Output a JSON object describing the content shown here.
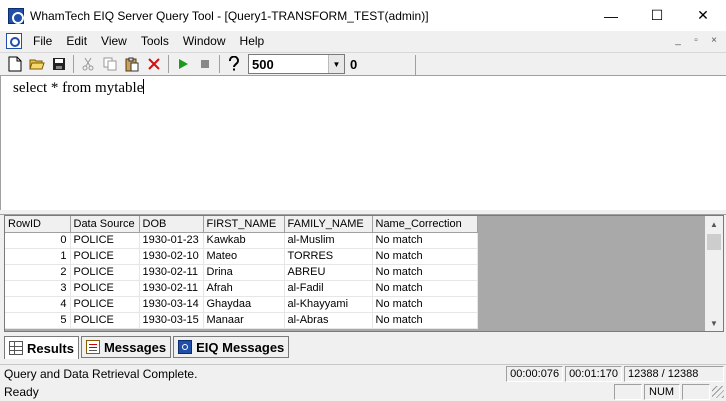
{
  "window": {
    "title": "WhamTech EIQ Server Query Tool - [Query1-TRANSFORM_TEST(admin)]",
    "minimize": "—",
    "maximize": "☐",
    "close": "✕"
  },
  "menu": {
    "items": [
      "File",
      "Edit",
      "View",
      "Tools",
      "Window",
      "Help"
    ],
    "mdi_minimize": "_",
    "mdi_restore": "▫",
    "mdi_close": "×"
  },
  "toolbar": {
    "row_limit": "500",
    "row_count": "0",
    "icons": {
      "new": "new-document-icon",
      "open": "open-folder-icon",
      "save": "save-icon",
      "cut": "cut-icon",
      "copy": "copy-icon",
      "paste": "paste-icon",
      "delete": "delete-icon",
      "run": "run-icon",
      "stop": "stop-icon",
      "help": "help-icon"
    },
    "colors": {
      "run": "#1a9a1a",
      "delete": "#d01010"
    }
  },
  "editor": {
    "query": "select * from mytable"
  },
  "results": {
    "columns": [
      "RowID",
      "Data Source",
      "DOB",
      "FIRST_NAME",
      "FAMILY_NAME",
      "Name_Correction"
    ],
    "rows": [
      [
        "0",
        "POLICE",
        "1930-01-23",
        "Kawkab",
        "al-Muslim",
        "No match"
      ],
      [
        "1",
        "POLICE",
        "1930-02-10",
        "Mateo",
        "TORRES",
        "No match"
      ],
      [
        "2",
        "POLICE",
        "1930-02-11",
        "Drina",
        "ABREU",
        "No match"
      ],
      [
        "3",
        "POLICE",
        "1930-02-11",
        "Afrah",
        "al-Fadil",
        "No match"
      ],
      [
        "4",
        "POLICE",
        "1930-03-14",
        "Ghaydaa",
        "al-Khayyami",
        "No match"
      ],
      [
        "5",
        "POLICE",
        "1930-03-15",
        "Manaar",
        "al-Abras",
        "No match"
      ]
    ]
  },
  "tabs": [
    {
      "label": "Results",
      "icon": "grid-icon",
      "active": true
    },
    {
      "label": "Messages",
      "icon": "messages-icon",
      "active": false
    },
    {
      "label": "EIQ Messages",
      "icon": "eiq-icon",
      "active": false
    }
  ],
  "status": {
    "message": "Query and Data Retrieval Complete.",
    "time1": "00:00:076",
    "time2": "00:01:170",
    "rows": "12388 / 12388",
    "ready": "Ready",
    "num": "NUM"
  }
}
